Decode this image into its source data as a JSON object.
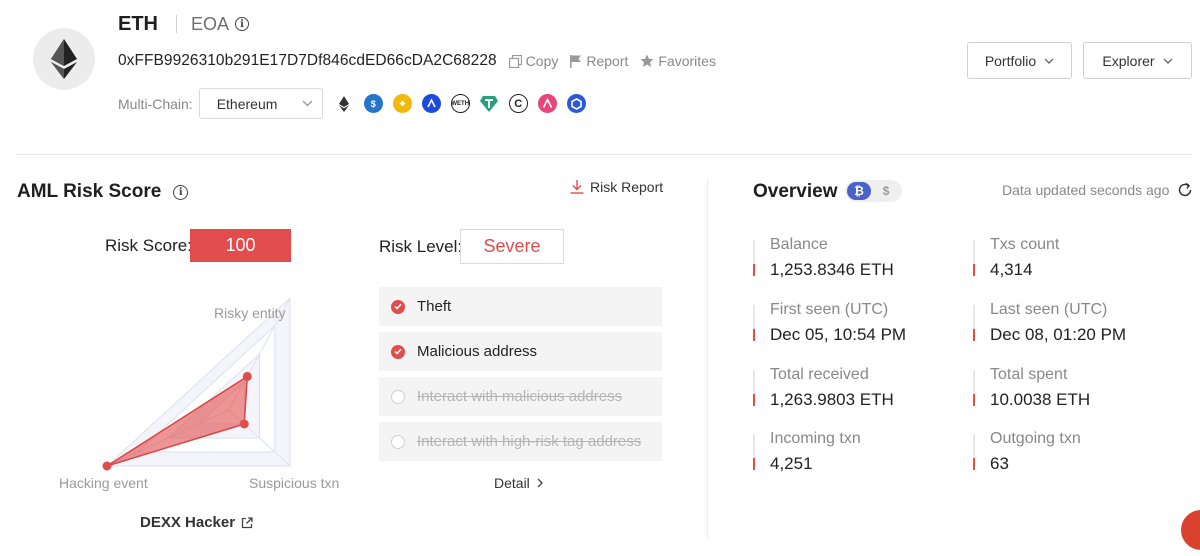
{
  "header": {
    "token": "ETH",
    "account_type": "EOA",
    "address": "0xFFB9926310b291E17D7Df846cdED66cDA2C68228",
    "actions": {
      "copy": "Copy",
      "report": "Report",
      "favorites": "Favorites"
    },
    "chain_label": "Multi-Chain:",
    "chain_selected": "Ethereum",
    "chain_icons": [
      "ethereum-icon",
      "usdc-icon",
      "bnb-icon",
      "arbitrum-icon",
      "weth-icon",
      "tether-icon",
      "c-token-icon",
      "aave-icon",
      "chainlink-icon"
    ],
    "portfolio_label": "Portfolio",
    "explorer_label": "Explorer"
  },
  "aml": {
    "title": "AML Risk Score",
    "risk_report": "Risk Report",
    "risk_score_label": "Risk Score:",
    "risk_score": "100",
    "risk_level_label": "Risk Level:",
    "risk_level": "Severe",
    "tags": [
      {
        "label": "Theft",
        "active": true
      },
      {
        "label": "Malicious address",
        "active": true
      },
      {
        "label": "Interact with malicious address",
        "active": false
      },
      {
        "label": "Interact with high-risk tag address",
        "active": false
      }
    ],
    "detail": "Detail",
    "radar": {
      "axes": [
        "Risky entity",
        "Suspicious txn",
        "Hacking event"
      ],
      "values": [
        0.3,
        0.25,
        1.0
      ]
    },
    "entity": "DEXX Hacker"
  },
  "overview": {
    "title": "Overview",
    "currency_btc": "₿",
    "currency_usd": "$",
    "updated": "Data updated seconds ago",
    "stats": [
      {
        "key": "Balance",
        "value": "1,253.8346 ETH"
      },
      {
        "key": "Txs count",
        "value": "4,314"
      },
      {
        "key": "First seen (UTC)",
        "value": "Dec 05, 10:54 PM"
      },
      {
        "key": "Last seen (UTC)",
        "value": "Dec 08, 01:20 PM"
      },
      {
        "key": "Total received",
        "value": "1,263.9803 ETH"
      },
      {
        "key": "Total spent",
        "value": "10.0038 ETH"
      },
      {
        "key": "Incoming txn",
        "value": "4,251"
      },
      {
        "key": "Outgoing txn",
        "value": "63"
      }
    ]
  },
  "colors": {
    "risk": "#e14c4c",
    "accent": "#4b63c9"
  }
}
